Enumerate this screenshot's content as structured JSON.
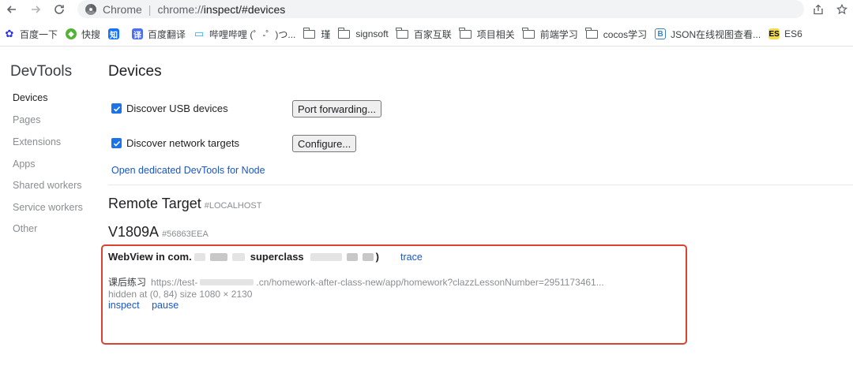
{
  "browser": {
    "site_name": "Chrome",
    "url_scheme": "chrome://",
    "url_main": "inspect/#devices"
  },
  "bookmarks": [
    {
      "label": "百度一下",
      "icon": "baidu-icon",
      "color": "#2932e1",
      "glyph": "✿"
    },
    {
      "label": "快搜",
      "icon": "kuaisou-icon",
      "color": "#52b436",
      "glyph": "◆"
    },
    {
      "label": "",
      "icon": "zhihu-icon",
      "color": "#1772f6",
      "glyph": "知"
    },
    {
      "label": "百度翻译",
      "icon": "baidu-translate-icon",
      "color": "#4e6ef2",
      "glyph": "译"
    },
    {
      "label": "哔哩哔哩 (゜-゜)つ...",
      "icon": "bilibili-icon",
      "color": "#23ade5",
      "glyph": "▭"
    },
    {
      "label": "瑾",
      "icon": "folder-icon"
    },
    {
      "label": "signsoft",
      "icon": "folder-icon"
    },
    {
      "label": "百家互联",
      "icon": "folder-icon"
    },
    {
      "label": "项目相关",
      "icon": "folder-icon"
    },
    {
      "label": "前端学习",
      "icon": "folder-icon"
    },
    {
      "label": "cocos学习",
      "icon": "folder-icon"
    },
    {
      "label": "JSON在线视图查看...",
      "icon": "json-viewer-icon",
      "color": "#3b82c4",
      "glyph": "B"
    },
    {
      "label": "ES6",
      "icon": "es6-icon",
      "color": "#f0db4f",
      "glyph": "ES"
    }
  ],
  "sidebar": {
    "title": "DevTools",
    "items": [
      {
        "label": "Devices",
        "active": true
      },
      {
        "label": "Pages"
      },
      {
        "label": "Extensions"
      },
      {
        "label": "Apps"
      },
      {
        "label": "Shared workers"
      },
      {
        "label": "Service workers"
      },
      {
        "label": "Other"
      }
    ]
  },
  "devices": {
    "heading": "Devices",
    "discover_usb": {
      "label": "Discover USB devices",
      "checked": true
    },
    "port_forwarding_button": "Port forwarding...",
    "discover_network": {
      "label": "Discover network targets",
      "checked": true
    },
    "configure_button": "Configure...",
    "node_link": "Open dedicated DevTools for Node"
  },
  "remote": {
    "heading": "Remote Target",
    "tag": "#LOCALHOST",
    "device_name": "V1809A",
    "device_id": "#56863EEA",
    "webview": {
      "title_prefix": "WebView in com.",
      "title_mid": "superclass",
      "title_end": ")",
      "trace_link": "trace",
      "page_name": "课后练习",
      "page_url_start": "https://test-",
      "page_url_end": ".cn/homework-after-class-new/app/homework?clazzLessonNumber=2951173461...",
      "status": "hidden  at (0, 84)  size 1080 × 2130",
      "inspect_link": "inspect",
      "pause_link": "pause"
    }
  },
  "colors": {
    "accent": "#1a73e8",
    "link": "#1a56c4",
    "highlight_border": "#d9432f"
  }
}
